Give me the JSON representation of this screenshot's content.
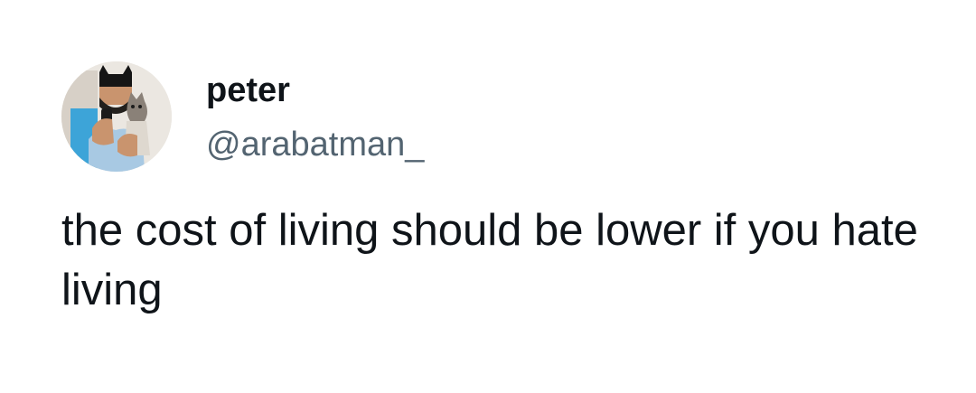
{
  "author": {
    "display_name": "peter",
    "handle": "@arabatman_"
  },
  "tweet": {
    "text": "the cost of living should be lower if you hate living"
  }
}
